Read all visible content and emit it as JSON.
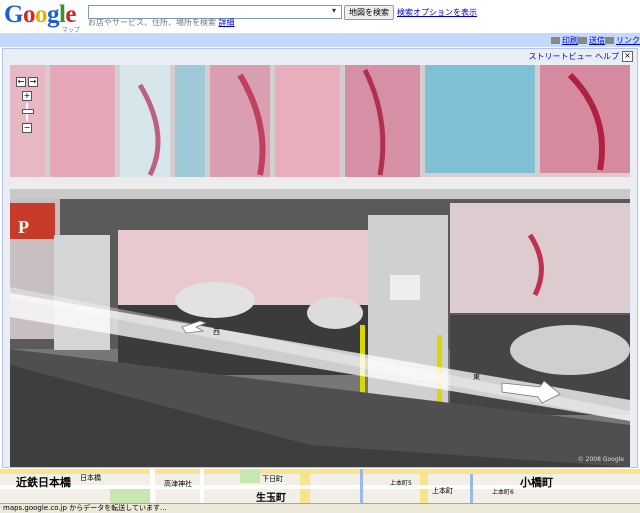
{
  "header": {
    "logo_text": "Google",
    "logo_sub": "マップ BETA",
    "search_value": "",
    "search_button": "地図を検索",
    "options_link": "検索オプションを表示",
    "hint_text": "お店やサービス、住所、場所を検索",
    "hint_link": "詳細"
  },
  "topbar": {
    "print": "印刷",
    "mail": "送信",
    "link": "リンク"
  },
  "streetview": {
    "help": "ストリートビュー ヘルプ",
    "close": "×",
    "controls": [
      "←",
      "→",
      "+",
      "−"
    ],
    "road_west": "西",
    "road_east": "東",
    "copyright": "© 2008 Google",
    "sign_letter": "P"
  },
  "map": {
    "labels": [
      "近鉄日本橋",
      "日本橋",
      "高津神社",
      "下日町",
      "上本町",
      "生玉町",
      "小橋町",
      "上本町5",
      "上本町6"
    ]
  },
  "status": {
    "text": "maps.google.co.jp からデータを転送しています..."
  },
  "colors": {
    "accent_bar": "#c3d9ff",
    "link": "#0000cc"
  }
}
